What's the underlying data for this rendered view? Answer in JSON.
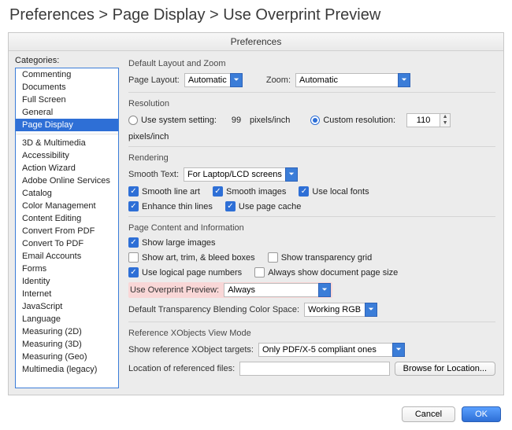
{
  "breadcrumb": "Preferences > Page Display > Use Overprint Preview",
  "window_title": "Preferences",
  "sidebar": {
    "label": "Categories:",
    "groups": [
      [
        "Commenting",
        "Documents",
        "Full Screen",
        "General",
        "Page Display"
      ],
      [
        "3D & Multimedia",
        "Accessibility",
        "Action Wizard",
        "Adobe Online Services",
        "Catalog",
        "Color Management",
        "Content Editing",
        "Convert From PDF",
        "Convert To PDF",
        "Email Accounts",
        "Forms",
        "Identity",
        "Internet",
        "JavaScript",
        "Language",
        "Measuring (2D)",
        "Measuring (3D)",
        "Measuring (Geo)",
        "Multimedia (legacy)"
      ]
    ],
    "selected": "Page Display"
  },
  "sections": {
    "layout": {
      "title": "Default Layout and Zoom",
      "page_layout_label": "Page Layout:",
      "page_layout_value": "Automatic",
      "zoom_label": "Zoom:",
      "zoom_value": "Automatic"
    },
    "resolution": {
      "title": "Resolution",
      "system_label": "Use system setting:",
      "system_value": "99",
      "pixels_inch": "pixels/inch",
      "custom_label": "Custom resolution:",
      "custom_value": "110"
    },
    "rendering": {
      "title": "Rendering",
      "smooth_text_label": "Smooth Text:",
      "smooth_text_value": "For Laptop/LCD screens",
      "cb_line_art": "Smooth line art",
      "cb_images": "Smooth images",
      "cb_local_fonts": "Use local fonts",
      "cb_thin_lines": "Enhance thin lines",
      "cb_page_cache": "Use page cache"
    },
    "page_content": {
      "title": "Page Content and Information",
      "cb_large_images": "Show large images",
      "cb_bleed": "Show art, trim, & bleed boxes",
      "cb_transparency_grid": "Show transparency grid",
      "cb_logical_pages": "Use logical page numbers",
      "cb_doc_page_size": "Always show document page size",
      "overprint_label": "Use Overprint Preview:",
      "overprint_value": "Always",
      "blend_label": "Default Transparency Blending Color Space:",
      "blend_value": "Working RGB"
    },
    "xobjects": {
      "title": "Reference XObjects View Mode",
      "targets_label": "Show reference XObject targets:",
      "targets_value": "Only PDF/X-5 compliant ones",
      "location_label": "Location of referenced files:",
      "location_value": "",
      "browse_label": "Browse for Location..."
    }
  },
  "footer": {
    "cancel": "Cancel",
    "ok": "OK"
  }
}
